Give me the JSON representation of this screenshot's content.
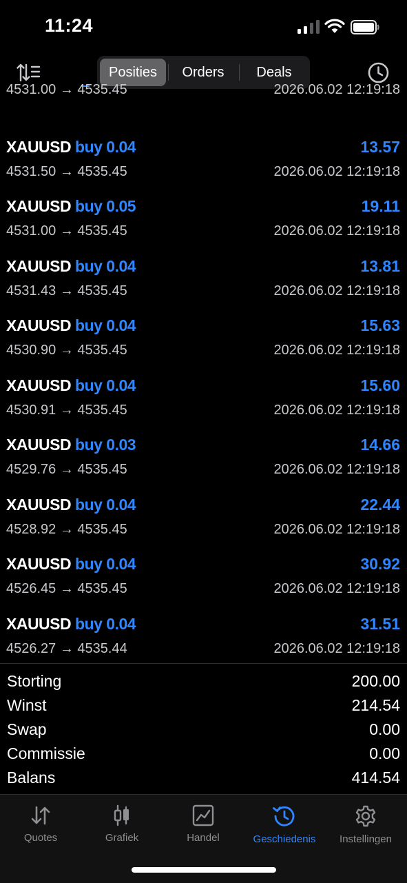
{
  "status_bar": {
    "time": "11:24"
  },
  "header": {
    "tabs": [
      {
        "label": "Posities",
        "active": true
      },
      {
        "label": "Orders",
        "active": false
      },
      {
        "label": "Deals",
        "active": false
      }
    ]
  },
  "deals": [
    {
      "symbol": "",
      "side": "",
      "profit": "",
      "open_price": "4531.00",
      "close_price": "4535.45",
      "datetime": "2026.06.02 12:19:18"
    },
    {
      "symbol": "XAUUSD",
      "side": "buy 0.04",
      "profit": "13.57",
      "open_price": "4531.50",
      "close_price": "4535.45",
      "datetime": "2026.06.02 12:19:18"
    },
    {
      "symbol": "XAUUSD",
      "side": "buy 0.05",
      "profit": "19.11",
      "open_price": "4531.00",
      "close_price": "4535.45",
      "datetime": "2026.06.02 12:19:18"
    },
    {
      "symbol": "XAUUSD",
      "side": "buy 0.04",
      "profit": "13.81",
      "open_price": "4531.43",
      "close_price": "4535.45",
      "datetime": "2026.06.02 12:19:18"
    },
    {
      "symbol": "XAUUSD",
      "side": "buy 0.04",
      "profit": "15.63",
      "open_price": "4530.90",
      "close_price": "4535.45",
      "datetime": "2026.06.02 12:19:18"
    },
    {
      "symbol": "XAUUSD",
      "side": "buy 0.04",
      "profit": "15.60",
      "open_price": "4530.91",
      "close_price": "4535.45",
      "datetime": "2026.06.02 12:19:18"
    },
    {
      "symbol": "XAUUSD",
      "side": "buy 0.03",
      "profit": "14.66",
      "open_price": "4529.76",
      "close_price": "4535.45",
      "datetime": "2026.06.02 12:19:18"
    },
    {
      "symbol": "XAUUSD",
      "side": "buy 0.04",
      "profit": "22.44",
      "open_price": "4528.92",
      "close_price": "4535.45",
      "datetime": "2026.06.02 12:19:18"
    },
    {
      "symbol": "XAUUSD",
      "side": "buy 0.04",
      "profit": "30.92",
      "open_price": "4526.45",
      "close_price": "4535.45",
      "datetime": "2026.06.02 12:19:18"
    },
    {
      "symbol": "XAUUSD",
      "side": "buy 0.04",
      "profit": "31.51",
      "open_price": "4526.27",
      "close_price": "4535.44",
      "datetime": "2026.06.02 12:19:18"
    }
  ],
  "price_arrow": "→",
  "summary": [
    {
      "label": "Storting",
      "value": "200.00"
    },
    {
      "label": "Winst",
      "value": "214.54"
    },
    {
      "label": "Swap",
      "value": "0.00"
    },
    {
      "label": "Commissie",
      "value": "0.00"
    },
    {
      "label": "Balans",
      "value": "414.54"
    }
  ],
  "tabbar": [
    {
      "label": "Quotes",
      "icon": "quotes-arrows-icon",
      "active": false
    },
    {
      "label": "Grafiek",
      "icon": "candlestick-icon",
      "active": false
    },
    {
      "label": "Handel",
      "icon": "trade-chart-icon",
      "active": false
    },
    {
      "label": "Geschiedenis",
      "icon": "history-clock-icon",
      "active": true
    },
    {
      "label": "Instellingen",
      "icon": "gear-icon",
      "active": false
    }
  ],
  "colors": {
    "accent": "#2f86ff",
    "background": "#000000",
    "secondary_text": "#c7c7cc",
    "inactive_tab": "#8e8e93"
  }
}
